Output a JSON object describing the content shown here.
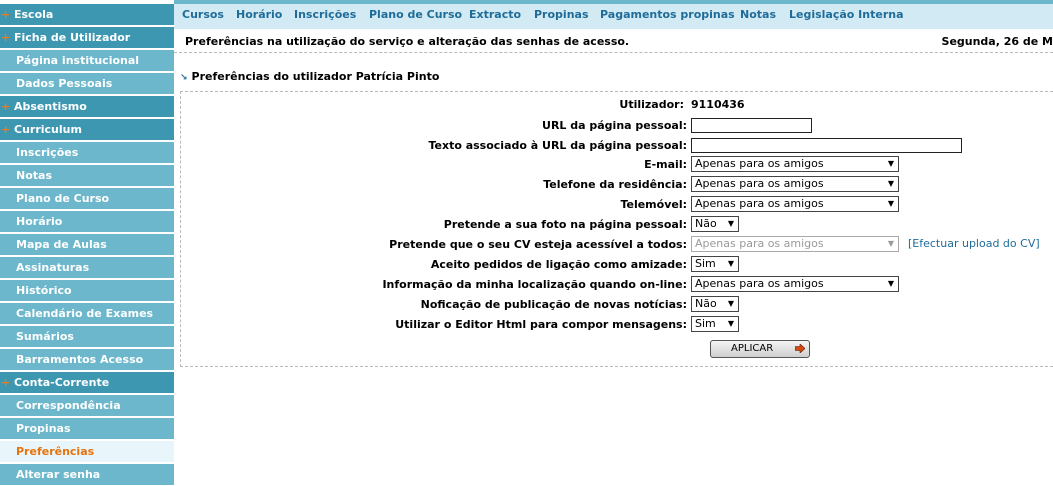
{
  "sidebar": {
    "items": [
      {
        "label": "Escola",
        "type": "section"
      },
      {
        "label": "Ficha de Utilizador",
        "type": "section"
      },
      {
        "label": "Página institucional",
        "type": "item"
      },
      {
        "label": "Dados Pessoais",
        "type": "item"
      },
      {
        "label": "Absentismo",
        "type": "section"
      },
      {
        "label": "Curriculum",
        "type": "section"
      },
      {
        "label": "Inscrições",
        "type": "item"
      },
      {
        "label": "Notas",
        "type": "item"
      },
      {
        "label": "Plano de Curso",
        "type": "item"
      },
      {
        "label": "Horário",
        "type": "item"
      },
      {
        "label": "Mapa de Aulas",
        "type": "item"
      },
      {
        "label": "Assinaturas",
        "type": "item"
      },
      {
        "label": "Histórico",
        "type": "item"
      },
      {
        "label": "Calendário de Exames",
        "type": "item"
      },
      {
        "label": "Sumários",
        "type": "item"
      },
      {
        "label": "Barramentos Acesso",
        "type": "item"
      },
      {
        "label": "Conta-Corrente",
        "type": "section"
      },
      {
        "label": "Correspondência",
        "type": "item"
      },
      {
        "label": "Propinas",
        "type": "item"
      },
      {
        "label": "Preferências",
        "type": "active"
      },
      {
        "label": "Alterar senha",
        "type": "item"
      }
    ]
  },
  "topnav": {
    "links": [
      "Cursos",
      "Horário",
      "Inscrições",
      "Plano de Curso",
      "Extracto",
      "Propinas",
      "Pagamentos propinas",
      "Notas",
      "Legislação Interna"
    ]
  },
  "infobar": {
    "description": "Preferências na utilização do serviço e alteração das senhas de acesso.",
    "date": "Segunda, 26 de M"
  },
  "section_title": "Preferências do utilizador Patrícia Pinto",
  "form": {
    "user_label": "Utilizador:",
    "user_value": "9110436",
    "url_label": "URL da página pessoal:",
    "url_value": "",
    "url_text_label": "Texto associado à URL da página pessoal:",
    "url_text_value": "",
    "email_label": "E-mail:",
    "email_value": "Apenas para os amigos",
    "phone_label": "Telefone da residência:",
    "phone_value": "Apenas para os amigos",
    "mobile_label": "Telemóvel:",
    "mobile_value": "Apenas para os amigos",
    "photo_label": "Pretende a sua foto na página pessoal:",
    "photo_value": "Não",
    "cv_label": "Pretende que o seu CV esteja acessível a todos:",
    "cv_value": "Apenas para os amigos",
    "cv_upload_link": "[Efectuar upload do CV]",
    "friend_label": "Aceito pedidos de ligação como amizade:",
    "friend_value": "Sim",
    "location_label": "Informação da minha localização quando on-line:",
    "location_value": "Apenas para os amigos",
    "news_label": "Noficação de publicação de novas notícias:",
    "news_value": "Não",
    "editor_label": "Utilizar o Editor Html para compor mensagens:",
    "editor_value": "Sim",
    "apply_label": "APLICAR"
  },
  "colors": {
    "sidebar_item": "#6cb7cc",
    "sidebar_section": "#3e97b1",
    "sidebar_active_text": "#e8720c",
    "nav_background": "#d2eaf3",
    "link": "#1f6c99"
  }
}
